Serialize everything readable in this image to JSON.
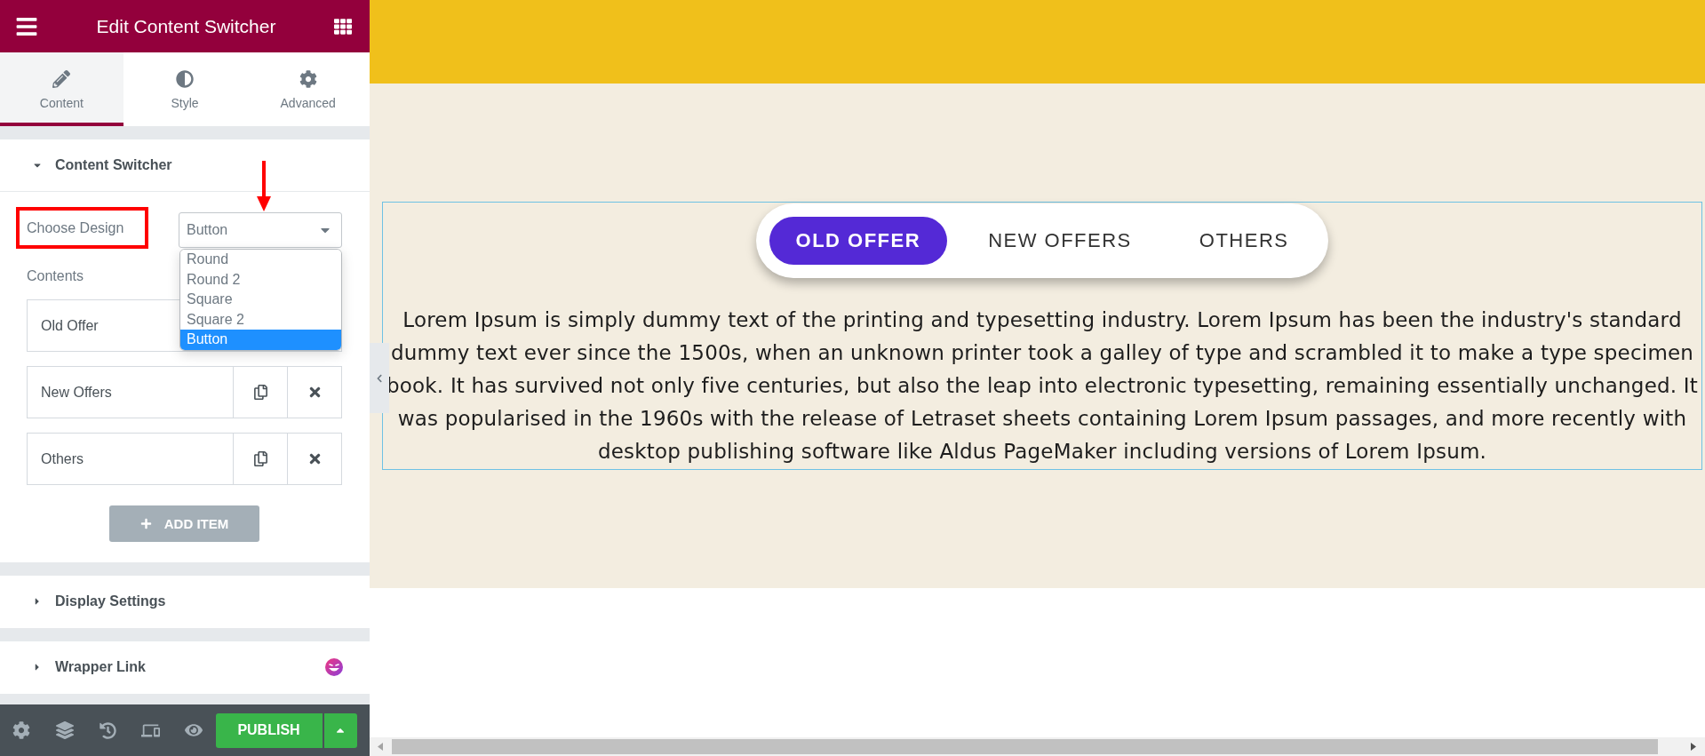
{
  "panel": {
    "header": {
      "title": "Edit Content Switcher"
    },
    "tabs": [
      {
        "label": "Content",
        "selected": true
      },
      {
        "label": "Style",
        "selected": false
      },
      {
        "label": "Advanced",
        "selected": false
      }
    ],
    "sections": [
      {
        "title": "Content Switcher",
        "expanded": true,
        "addon_badge": false,
        "design_field": {
          "label": "Choose Design",
          "highlighted": true,
          "value": "Button",
          "expanded": true,
          "options": [
            {
              "label": "Round",
              "selected": false
            },
            {
              "label": "Round 2",
              "selected": false
            },
            {
              "label": "Square",
              "selected": false
            },
            {
              "label": "Square 2",
              "selected": false
            },
            {
              "label": "Button",
              "selected": true
            }
          ]
        },
        "contents_label": "Contents",
        "items": [
          {
            "title": "Old Offer"
          },
          {
            "title": "New Offers"
          },
          {
            "title": "Others"
          }
        ],
        "add_button": "ADD ITEM"
      },
      {
        "title": "Display Settings",
        "expanded": false,
        "addon_badge": false
      },
      {
        "title": "Wrapper Link",
        "expanded": false,
        "addon_badge": true
      }
    ],
    "footer": {
      "publish_label": "PUBLISH"
    }
  },
  "preview": {
    "switcher": [
      {
        "label": "OLD OFFER",
        "selected": true
      },
      {
        "label": "NEW OFFERS",
        "selected": false
      },
      {
        "label": "OTHERS",
        "selected": false
      }
    ],
    "paragraph": "Lorem Ipsum is simply dummy text of the printing and typesetting industry. Lorem Ipsum has been the industry's standard dummy text ever since the 1500s, when an unknown printer took a galley of type and scrambled it to make a type specimen book. It has survived not only five centuries, but also the leap into electronic typesetting, remaining essentially unchanged. It was popularised in the 1960s with the release of Letraset sheets containing Lorem Ipsum passages, and more recently with desktop publishing software like Aldus PageMaker including versions of Lorem Ipsum."
  }
}
